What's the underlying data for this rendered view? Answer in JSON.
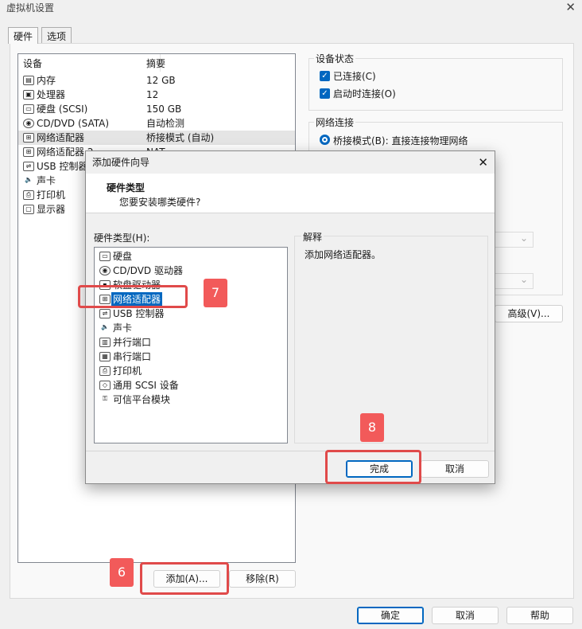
{
  "window": {
    "title": "虚拟机设置"
  },
  "tabs": [
    {
      "label": "硬件"
    },
    {
      "label": "选项"
    }
  ],
  "device_list": {
    "headers": {
      "device": "设备",
      "summary": "摘要"
    },
    "rows": [
      {
        "icon": "memory-icon",
        "name": "内存",
        "summary": "12 GB"
      },
      {
        "icon": "cpu-icon",
        "name": "处理器",
        "summary": "12"
      },
      {
        "icon": "harddisk-icon",
        "name": "硬盘 (SCSI)",
        "summary": "150 GB"
      },
      {
        "icon": "cd-icon",
        "name": "CD/DVD (SATA)",
        "summary": "自动检测"
      },
      {
        "icon": "network-icon",
        "name": "网络适配器",
        "summary": "桥接模式 (自动)"
      },
      {
        "icon": "network-icon",
        "name": "网络适配器 2",
        "summary": "NAT"
      },
      {
        "icon": "usb-icon",
        "name": "USB 控制器",
        "summary": ""
      },
      {
        "icon": "sound-icon",
        "name": "声卡",
        "summary": ""
      },
      {
        "icon": "printer-icon",
        "name": "打印机",
        "summary": ""
      },
      {
        "icon": "display-icon",
        "name": "显示器",
        "summary": ""
      }
    ]
  },
  "device_status": {
    "title": "设备状态",
    "connected": "已连接(C)",
    "connect_at_power_on": "启动时连接(O)"
  },
  "network_connection": {
    "title": "网络连接",
    "bridged": "桥接模式(B): 直接连接物理网络",
    "advanced_label": "高级(V)..."
  },
  "main_buttons": {
    "add": "添加(A)...",
    "remove": "移除(R)",
    "ok": "确定",
    "cancel": "取消",
    "help": "帮助"
  },
  "wizard": {
    "title": "添加硬件向导",
    "heading": "硬件类型",
    "subheading": "您要安装哪类硬件?",
    "list_label": "硬件类型(H):",
    "items": [
      {
        "icon": "harddisk-icon",
        "label": "硬盘"
      },
      {
        "icon": "cd-icon",
        "label": "CD/DVD 驱动器"
      },
      {
        "icon": "floppy-icon",
        "label": "软盘驱动器"
      },
      {
        "icon": "network-icon",
        "label": "网络适配器"
      },
      {
        "icon": "usb-icon",
        "label": "USB 控制器"
      },
      {
        "icon": "sound-icon",
        "label": "声卡"
      },
      {
        "icon": "parallel-port-icon",
        "label": "并行端口"
      },
      {
        "icon": "serial-port-icon",
        "label": "串行端口"
      },
      {
        "icon": "printer-icon",
        "label": "打印机"
      },
      {
        "icon": "scsi-icon",
        "label": "通用 SCSI 设备"
      },
      {
        "icon": "tpm-icon",
        "label": "可信平台模块"
      }
    ],
    "explain_label": "解释",
    "explain_text": "添加网络适配器。",
    "finish": "完成",
    "cancel": "取消"
  },
  "annotations": {
    "step6": "6",
    "step7": "7",
    "step8": "8"
  }
}
